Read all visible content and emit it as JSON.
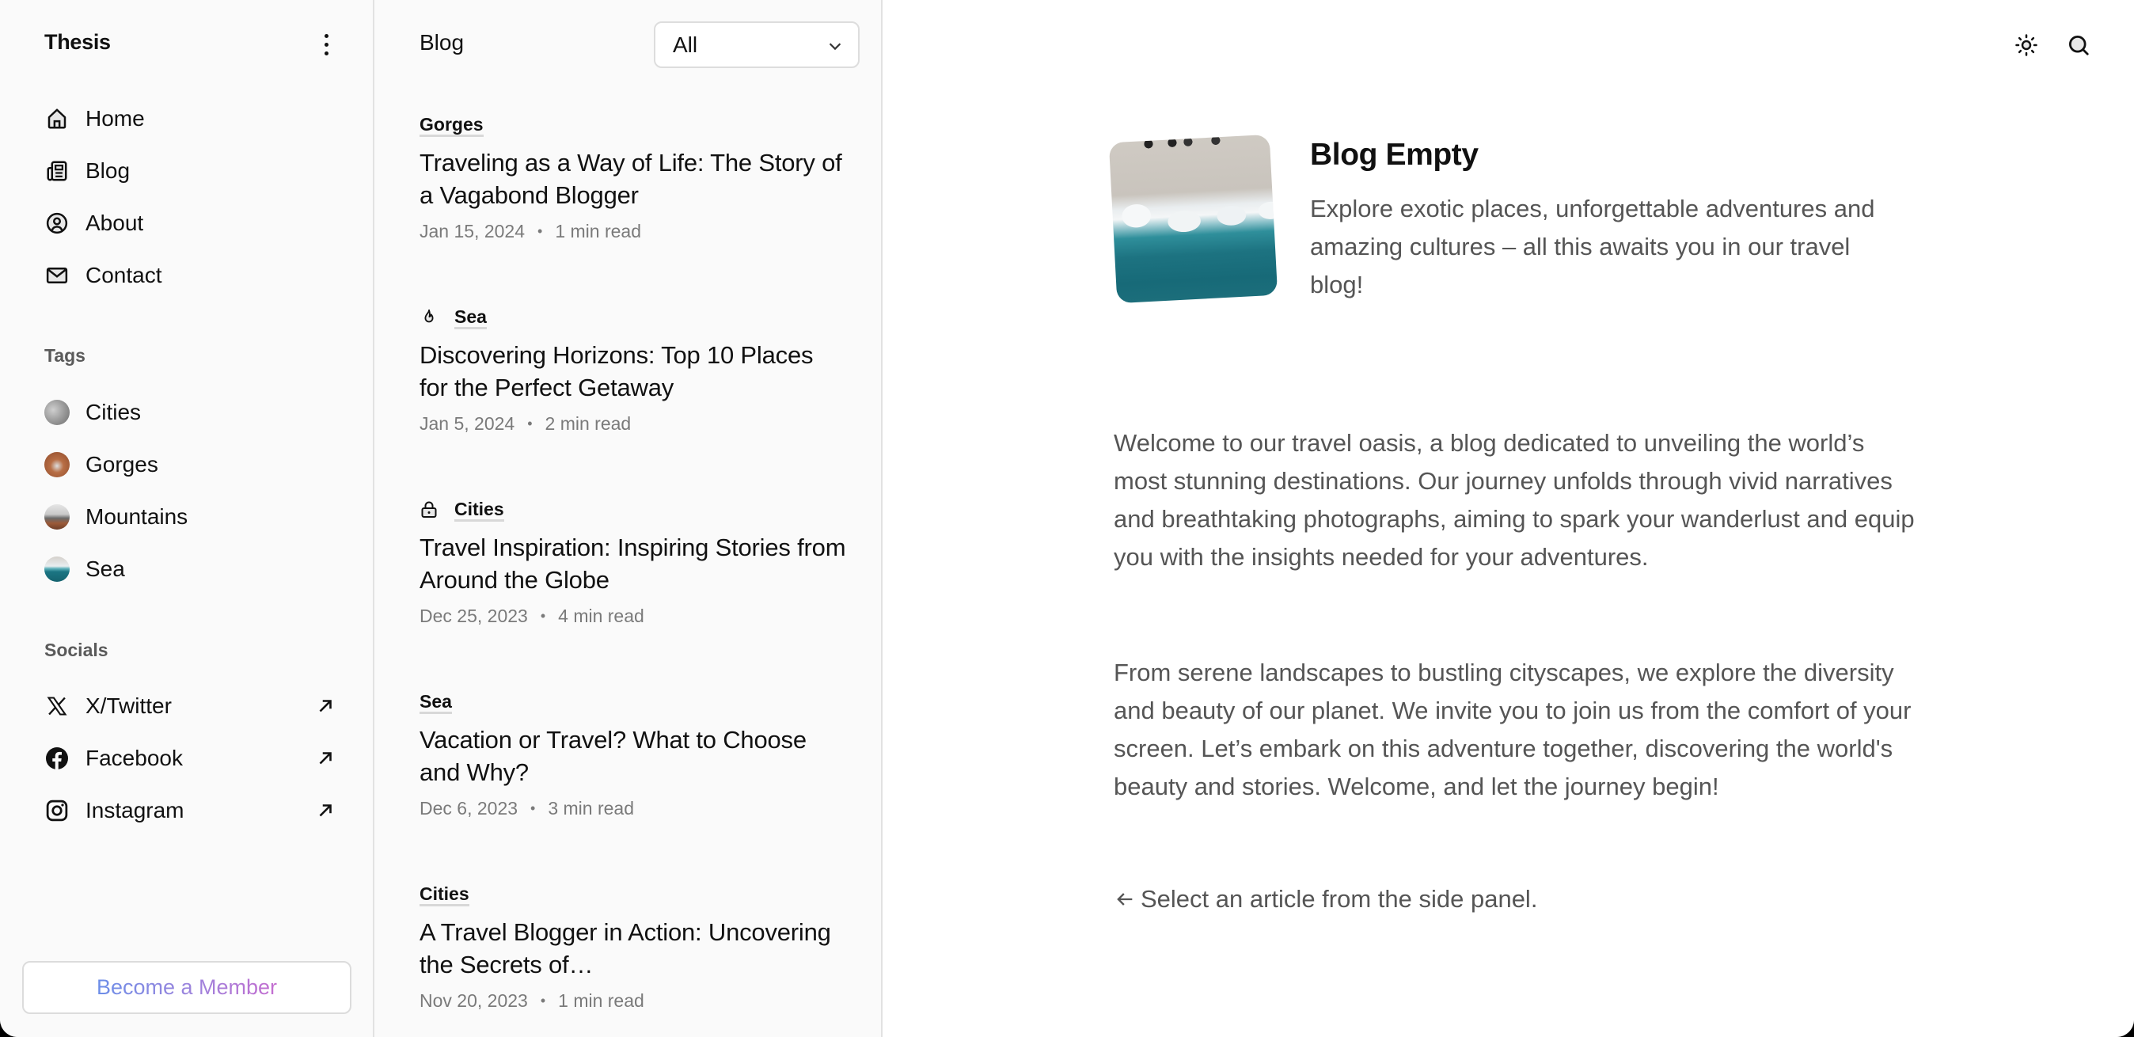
{
  "sidebar": {
    "brand": "Thesis",
    "nav": [
      {
        "label": "Home",
        "icon": "home-icon"
      },
      {
        "label": "Blog",
        "icon": "newspaper-icon"
      },
      {
        "label": "About",
        "icon": "user-circle-icon"
      },
      {
        "label": "Contact",
        "icon": "mail-icon"
      }
    ],
    "tags_label": "Tags",
    "tags": [
      {
        "label": "Cities",
        "color": "#9a9a9a"
      },
      {
        "label": "Gorges",
        "color": "#9a5a3a"
      },
      {
        "label": "Mountains",
        "color": "#8a6a55"
      },
      {
        "label": "Sea",
        "color": "#1f7a86"
      }
    ],
    "socials_label": "Socials",
    "socials": [
      {
        "label": "X/Twitter",
        "icon": "x-twitter-icon"
      },
      {
        "label": "Facebook",
        "icon": "facebook-icon"
      },
      {
        "label": "Instagram",
        "icon": "instagram-icon"
      }
    ],
    "member_button": "Become a Member"
  },
  "list": {
    "title": "Blog",
    "filter": {
      "selected": "All"
    },
    "articles": [
      {
        "tag": "Gorges",
        "badge": null,
        "title": "Traveling as a Way of Life: The Story of a Vagabond Blogger",
        "date": "Jan 15, 2024",
        "read_time": "1 min read"
      },
      {
        "tag": "Sea",
        "badge": "flame-icon",
        "title": "Discovering Horizons: Top 10 Places for the Perfect Getaway",
        "date": "Jan 5, 2024",
        "read_time": "2 min read"
      },
      {
        "tag": "Cities",
        "badge": "lock-icon",
        "title": "Travel Inspiration: Inspiring Stories from Around the Globe",
        "date": "Dec 25, 2023",
        "read_time": "4 min read"
      },
      {
        "tag": "Sea",
        "badge": null,
        "title": "Vacation or Travel? What to Choose and Why?",
        "date": "Dec 6, 2023",
        "read_time": "3 min read"
      },
      {
        "tag": "Cities",
        "badge": null,
        "title": "A Travel Blogger in Action: Uncovering the Secrets of…",
        "date": "Nov 20, 2023",
        "read_time": "1 min read"
      }
    ],
    "meta_separator": "•"
  },
  "main": {
    "title": "Blog Empty",
    "description": "Explore exotic places, unforgettable adventures and amazing cultures – all this awaits you in our travel blog!",
    "paragraphs": [
      "Welcome to our travel oasis, a blog dedicated to unveiling the world’s most stunning destinations. Our journey unfolds through vivid narratives and breathtaking photographs, aiming to spark your wanderlust and equip you with the insights needed for your adventures.",
      "From serene landscapes to bustling cityscapes, we explore the diversity and beauty of our planet. We invite you to join us from the comfort of your screen. Let’s embark on this adventure together, discovering the world's beauty and stories. Welcome, and let the journey begin!"
    ],
    "hint": "Select an article from the side panel.",
    "toolbar": {
      "theme_icon": "sun-icon",
      "search_icon": "search-icon"
    }
  }
}
